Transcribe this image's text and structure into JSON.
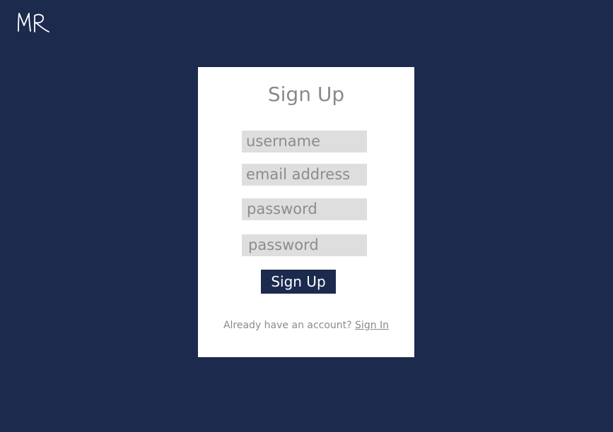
{
  "logo": {
    "initials": "MR"
  },
  "signup": {
    "title": "Sign Up",
    "fields": [
      {
        "placeholder": "username",
        "value": ""
      },
      {
        "placeholder": "email address",
        "value": ""
      },
      {
        "placeholder": "password",
        "value": ""
      },
      {
        "placeholder": "password",
        "value": ""
      }
    ],
    "submit_label": "Sign Up",
    "footer_text": "Already have an account?",
    "signin_link": "Sign In"
  },
  "colors": {
    "background": "#1c2a4e",
    "card": "#ffffff",
    "field_bg": "#dedede",
    "text_muted": "#8a8a8a",
    "button_bg": "#1c2a4e",
    "button_text": "#ffffff"
  }
}
